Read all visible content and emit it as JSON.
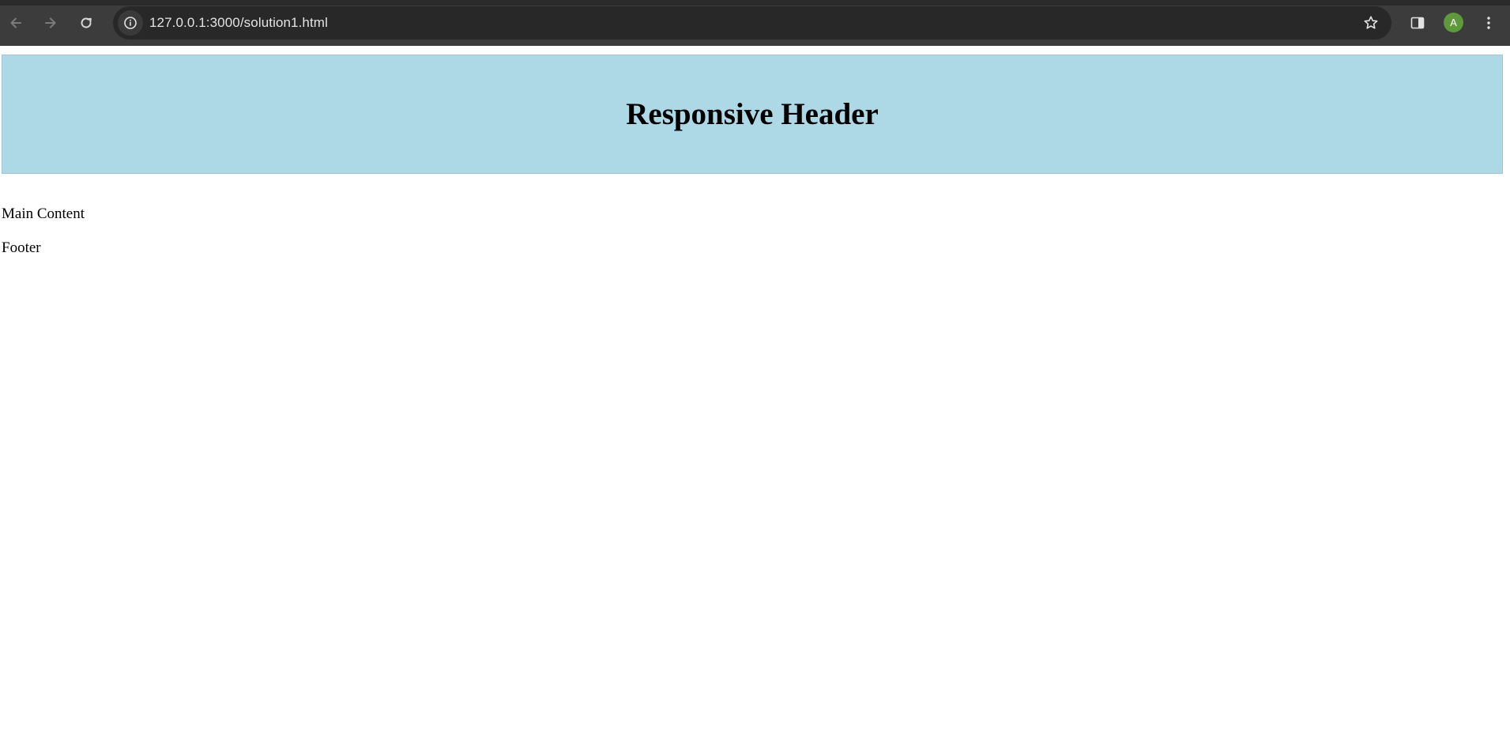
{
  "browser": {
    "url": "127.0.0.1:3000/solution1.html",
    "profile_initial": "A",
    "icons": {
      "back": "arrow-left-icon",
      "forward": "arrow-right-icon",
      "reload": "reload-icon",
      "site_info": "info-icon",
      "bookmark": "star-icon",
      "side_panel": "side-panel-icon",
      "menu": "kebab-menu-icon"
    },
    "colors": {
      "toolbar": "#3c3c3c",
      "omnibox": "#282828",
      "avatar": "#5f9a3a"
    }
  },
  "page": {
    "header_title": "Responsive Header",
    "main_text": "Main Content",
    "footer_text": "Footer",
    "colors": {
      "header_bg": "#add8e6"
    }
  }
}
